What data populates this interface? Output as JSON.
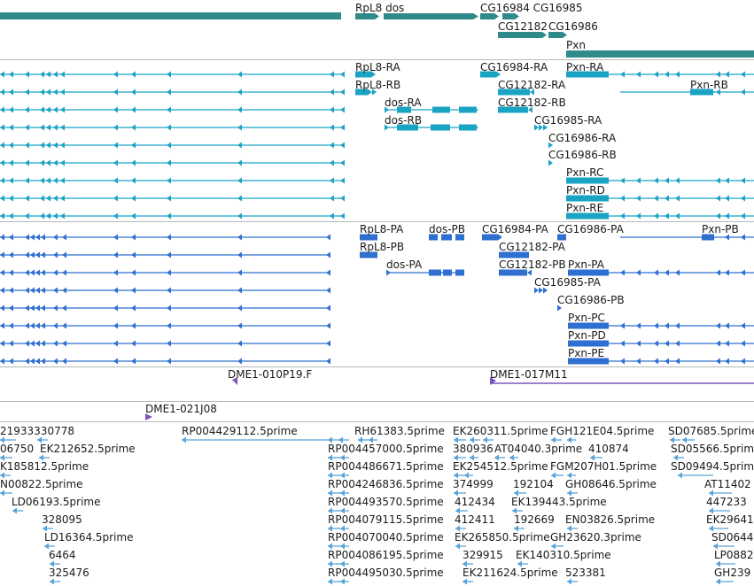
{
  "colors": {
    "gene": "#2e8b89",
    "rna_ra": "#1ba3c4",
    "protein": "#2f6fd0",
    "bac": "#7a55c0",
    "est": "#5aa3d8",
    "separator": "#b8b8b8",
    "text": "#1a1a1a"
  },
  "gene_track": {
    "labels": [
      "RpL8 dos",
      "CG16984 CG16985",
      "CG12182",
      "CG16986",
      "Pxn"
    ]
  },
  "transcript_track": {
    "labels": [
      "RpL8-RA",
      "RpL8-RB",
      "dos-RA",
      "dos-RB",
      "CG16984-RA",
      "CG12182-RA",
      "CG12182-RB",
      "CG16985-RA",
      "CG16986-RA",
      "CG16986-RB",
      "Pxn-RA",
      "Pxn-RB",
      "Pxn-RC",
      "Pxn-RD",
      "Pxn-RE"
    ]
  },
  "protein_track": {
    "labels": [
      "RpL8-PA",
      "dos-PB",
      "CG16984-PA",
      "CG16986-PA",
      "Pxn-PB",
      "RpL8-PB",
      "CG12182-PA",
      "dos-PA",
      "CG12182-PB",
      "Pxn-PA",
      "CG16985-PA",
      "CG16986-PB",
      "Pxn-PC",
      "Pxn-PD",
      "Pxn-PE"
    ]
  },
  "bac_track": {
    "labels": [
      "DME1-010P19.F",
      "DME1-017M11",
      "DME1-021J08"
    ]
  },
  "est_track": {
    "labels": [
      "21933330778",
      "RP004429112.5prime",
      "RH61383.5prime",
      "EK260311.5prime",
      "FGH121E04.5prime",
      "SD07685.5prime",
      "06750",
      "EK212652.5prime",
      "RP004457000.5prime",
      "380936",
      "AT04040.3prime",
      "410874",
      "SD05566.5prime",
      "K185812.5prime",
      "RP004486671.5prime",
      "EK254512.5prime",
      "FGM207H01.5prime",
      "SD09494.5prime",
      "N00822.5prime",
      "RP004246836.5prime",
      "374999",
      "192104",
      "GH08646.5prime",
      "AT11402",
      "LD06193.5prime",
      "RP004493570.5prime",
      "412434",
      "EK139443.5prime",
      "447233",
      "328095",
      "RP004079115.5prime",
      "412411",
      "192669",
      "EN03826.5prime",
      "EK29641",
      "LD16364.5prime",
      "RP004070040.5prime",
      "EK265850.5prime",
      "GH23620.3prime",
      "SD0644",
      "6464",
      "RP004086195.5prime",
      "329915",
      "EK140310.5prime",
      "LP0882",
      "325476",
      "RP004495030.5prime",
      "EK211624.5prime",
      "523381",
      "GH239"
    ]
  }
}
